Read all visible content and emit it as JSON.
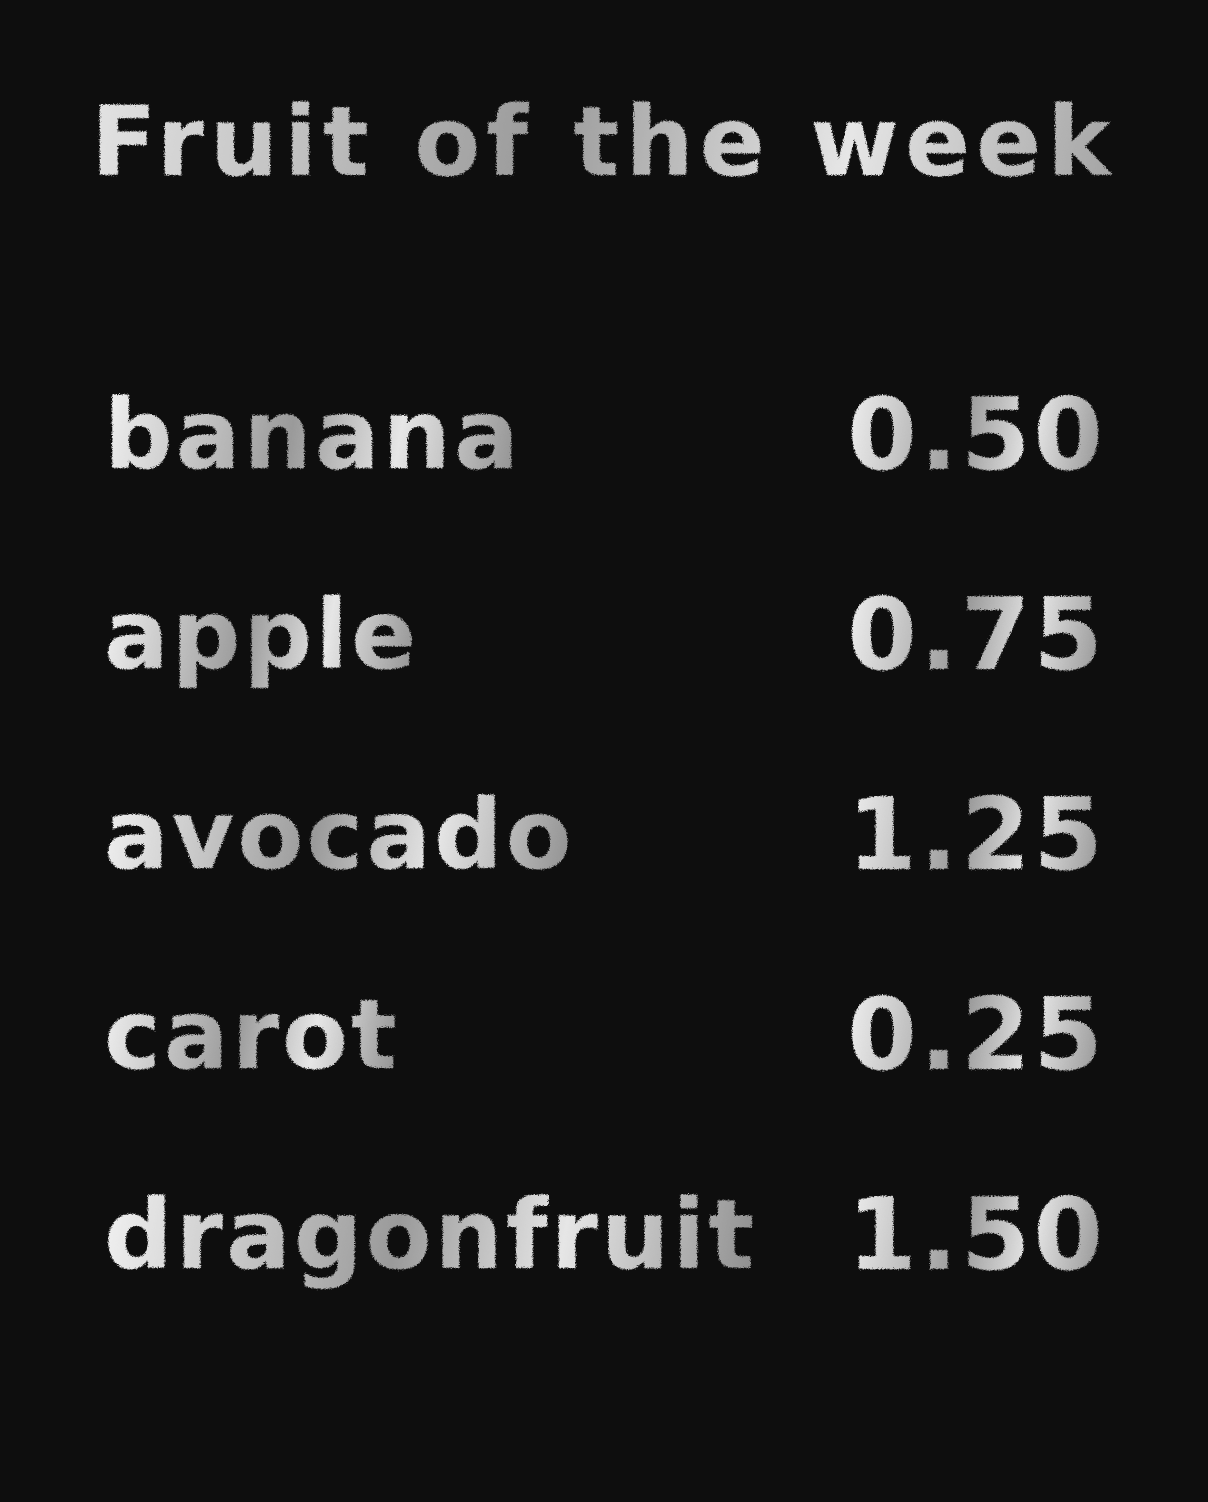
{
  "title": "Fruit of the week",
  "items": [
    {
      "name": "banana",
      "price": "0.50"
    },
    {
      "name": "apple",
      "price": "0.75"
    },
    {
      "name": "avocado",
      "price": "1.25"
    },
    {
      "name": "carot",
      "price": "0.25"
    },
    {
      "name": "dragonfruit",
      "price": "1.50"
    }
  ],
  "colors": {
    "background": "#0e0e0e",
    "chalk_light": "#f2f2f2",
    "chalk_dark": "#8c8c8c"
  }
}
